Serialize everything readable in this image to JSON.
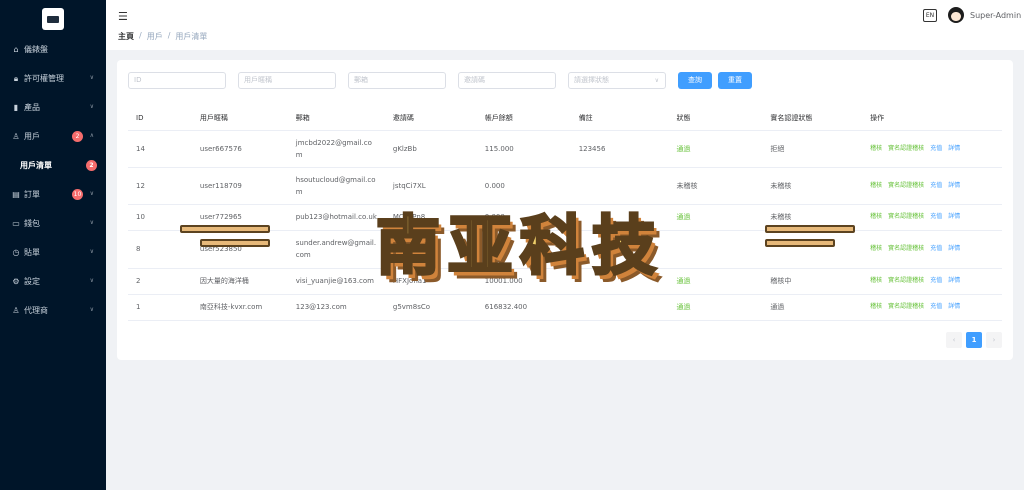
{
  "sidebar": {
    "items": [
      {
        "label": "儀錶盤",
        "icon": "home-icon"
      },
      {
        "label": "許可權管理",
        "icon": "lock-icon"
      },
      {
        "label": "產品",
        "icon": "chart-icon"
      },
      {
        "label": "用戶",
        "icon": "user-icon",
        "badge": "2"
      },
      {
        "label": "用戶清單",
        "badge": "2"
      },
      {
        "label": "訂單",
        "icon": "order-icon",
        "badge": "10"
      },
      {
        "label": "錢包",
        "icon": "wallet-icon"
      },
      {
        "label": "貼單",
        "icon": "clock-icon"
      },
      {
        "label": "設定",
        "icon": "gear-icon"
      },
      {
        "label": "代理商",
        "icon": "user-icon"
      }
    ]
  },
  "header": {
    "breadcrumb": [
      "主頁",
      "用戶",
      "用戶清單"
    ],
    "lang": "EN",
    "username": "Super-Admin"
  },
  "filters": {
    "id_placeholder": "ID",
    "username_placeholder": "用戶暱稱",
    "email_placeholder": "郵箱",
    "invite_placeholder": "邀請碼",
    "status_placeholder": "請選擇狀態",
    "search_label": "查詢",
    "reset_label": "重置"
  },
  "table": {
    "headers": [
      "ID",
      "用戶暱稱",
      "郵箱",
      "邀請碼",
      "帳戶餘額",
      "備註",
      "狀態",
      "實名認證狀態",
      "操作"
    ],
    "rows": [
      {
        "id": "14",
        "name": "user667576",
        "email": "jmcbd2022@gmail.com",
        "code": "gKlzBb",
        "balance": "115.000",
        "note": "123456",
        "status": "通過",
        "kyc": "拒絕"
      },
      {
        "id": "12",
        "name": "user118709",
        "email": "hsoutucloud@gmail.com",
        "code": "jstqCi7XL",
        "balance": "0.000",
        "note": "",
        "status": "未稽核",
        "kyc": "未稽核"
      },
      {
        "id": "10",
        "name": "user772965",
        "email": "pub123@hotmail.co.uk",
        "code": "MCTvPn8",
        "balance": "0.000",
        "note": "",
        "status": "通過",
        "kyc": "未稽核"
      },
      {
        "id": "8",
        "name": "user523850",
        "email": "sunder.andrew@gmail.com",
        "code": "DHhtAtg",
        "balance": "0.000",
        "note": "",
        "status": "",
        "kyc": ""
      },
      {
        "id": "2",
        "name": "因大量的海洋桶",
        "email": "visi_yuanjie@163.com",
        "code": "HFXJona1",
        "balance": "10001.000",
        "note": "",
        "status": "通過",
        "kyc": "稽核中"
      },
      {
        "id": "1",
        "name": "南亞科技-kvxr.com",
        "email": "123@123.com",
        "code": "g5vm8sCo",
        "balance": "616832.400",
        "note": "",
        "status": "通過",
        "kyc": "通過"
      }
    ],
    "ops": [
      "稽核",
      "實名認證稽核",
      "充值",
      "詳情"
    ]
  },
  "pagination": {
    "prev": "‹",
    "current": "1",
    "next": "›"
  },
  "watermark": "南亚科技",
  "colors": {
    "sidebar_bg": "#001529",
    "accent": "#409eff",
    "success": "#67c23a",
    "danger": "#f56c6c"
  }
}
